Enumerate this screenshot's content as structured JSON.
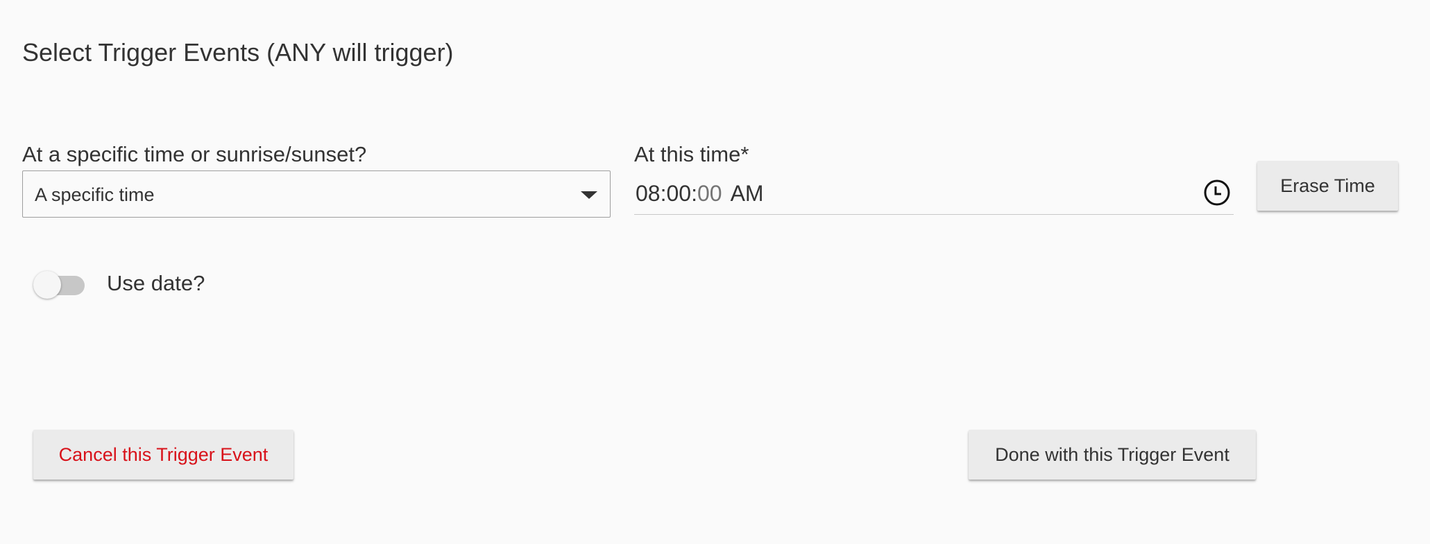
{
  "header": {
    "title": "Select Trigger Events (ANY will trigger)"
  },
  "trigger_form": {
    "mode_label": "At a specific time or sunrise/sunset?",
    "mode_value": "A specific time",
    "time_label": "At this time*",
    "time": {
      "hours": "08",
      "minutes": "00",
      "seconds": "00",
      "period": "AM"
    },
    "erase_label": "Erase Time",
    "use_date_label": "Use date?",
    "use_date_on": false
  },
  "footer": {
    "cancel_label": "Cancel this Trigger Event",
    "done_label": "Done with this Trigger Event"
  },
  "colors": {
    "cancel_text": "#d8121a",
    "button_bg": "#ebebeb",
    "toggle_track_off": "#c7c7c7"
  },
  "icons": {
    "dropdown": "caret-down-icon",
    "time_picker": "clock-icon"
  }
}
